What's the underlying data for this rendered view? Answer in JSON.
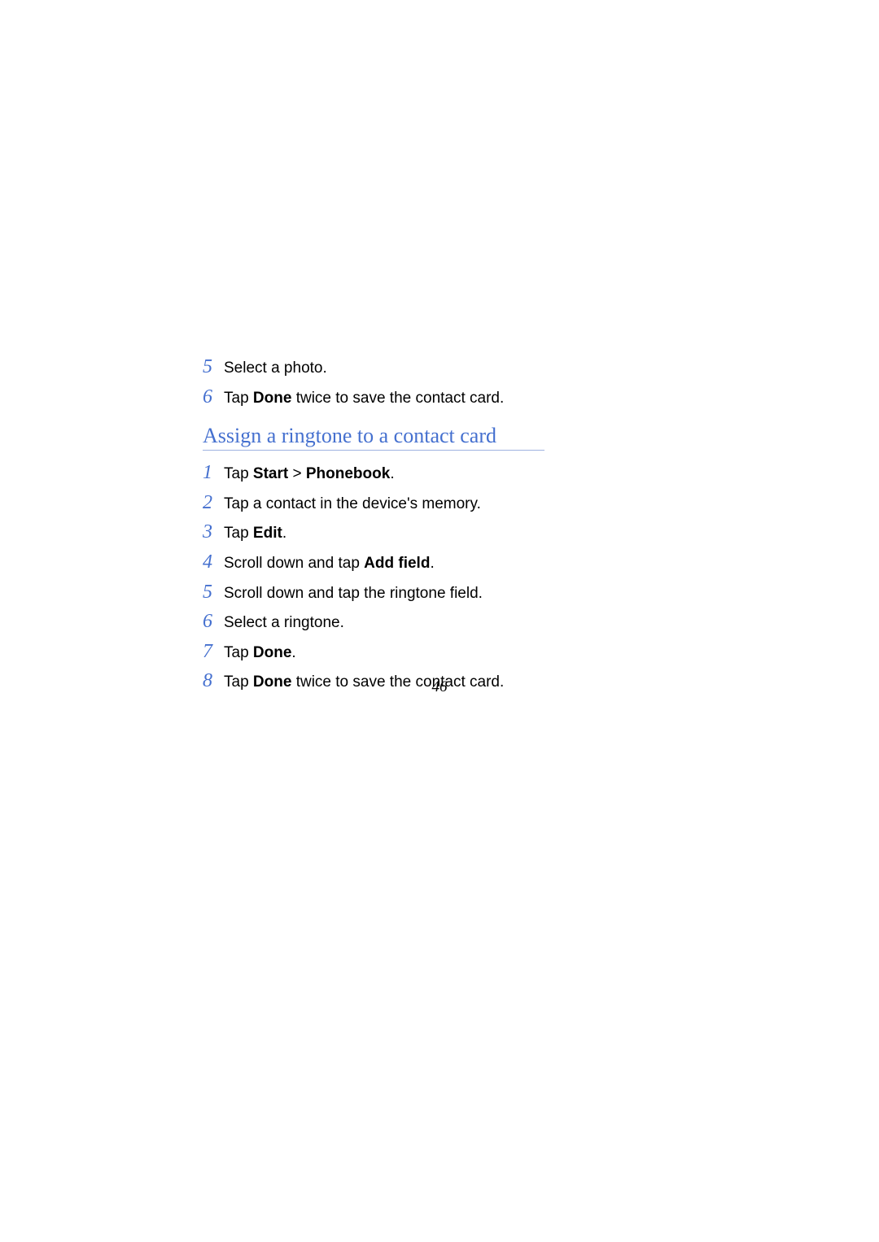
{
  "page_number": "46",
  "section1_steps": [
    {
      "num": "5",
      "parts": [
        {
          "t": "Select a photo.",
          "b": false
        }
      ]
    },
    {
      "num": "6",
      "parts": [
        {
          "t": "Tap ",
          "b": false
        },
        {
          "t": "Done",
          "b": true
        },
        {
          "t": " twice to save the contact card.",
          "b": false
        }
      ]
    }
  ],
  "heading": "Assign a ringtone to a contact card",
  "section2_steps": [
    {
      "num": "1",
      "parts": [
        {
          "t": "Tap ",
          "b": false
        },
        {
          "t": "Start",
          "b": true
        },
        {
          "t": " > ",
          "b": false
        },
        {
          "t": "Phonebook",
          "b": true
        },
        {
          "t": ".",
          "b": false
        }
      ]
    },
    {
      "num": "2",
      "parts": [
        {
          "t": "Tap a contact in the device's memory.",
          "b": false
        }
      ]
    },
    {
      "num": "3",
      "parts": [
        {
          "t": "Tap ",
          "b": false
        },
        {
          "t": "Edit",
          "b": true
        },
        {
          "t": ".",
          "b": false
        }
      ]
    },
    {
      "num": "4",
      "parts": [
        {
          "t": "Scroll down and tap ",
          "b": false
        },
        {
          "t": "Add field",
          "b": true
        },
        {
          "t": ".",
          "b": false
        }
      ]
    },
    {
      "num": "5",
      "parts": [
        {
          "t": "Scroll down and tap the ringtone field.",
          "b": false
        }
      ]
    },
    {
      "num": "6",
      "parts": [
        {
          "t": "Select a ringtone.",
          "b": false
        }
      ]
    },
    {
      "num": "7",
      "parts": [
        {
          "t": "Tap ",
          "b": false
        },
        {
          "t": "Done",
          "b": true
        },
        {
          "t": ".",
          "b": false
        }
      ]
    },
    {
      "num": "8",
      "parts": [
        {
          "t": "Tap ",
          "b": false
        },
        {
          "t": "Done",
          "b": true
        },
        {
          "t": " twice to save the contact card.",
          "b": false
        }
      ]
    }
  ]
}
